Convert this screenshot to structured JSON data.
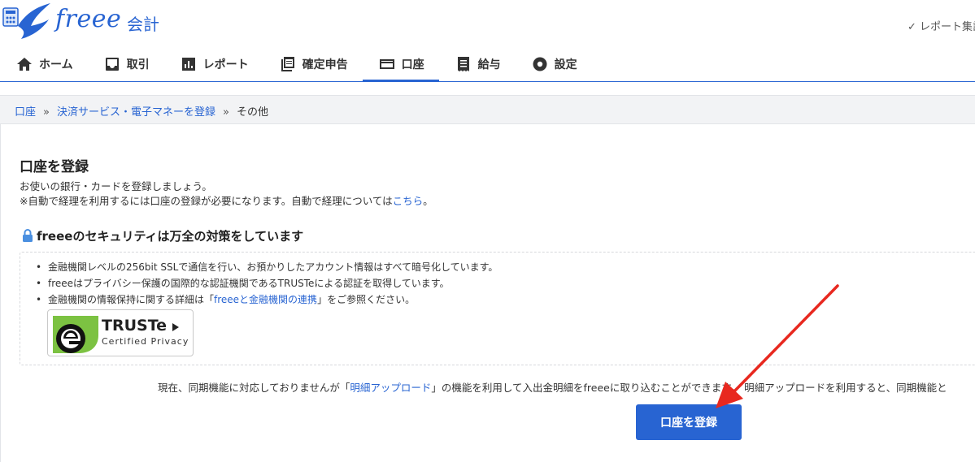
{
  "header": {
    "logo_text": "freee",
    "product": "会計",
    "report_link": "✓ レポート集計"
  },
  "nav": {
    "items": [
      {
        "label": "ホーム",
        "icon": "home-icon"
      },
      {
        "label": "取引",
        "icon": "inbox-icon"
      },
      {
        "label": "レポート",
        "icon": "bar-chart-icon"
      },
      {
        "label": "確定申告",
        "icon": "document-stack-icon"
      },
      {
        "label": "口座",
        "icon": "card-icon"
      },
      {
        "label": "給与",
        "icon": "receipt-icon"
      },
      {
        "label": "設定",
        "icon": "gear-icon"
      }
    ],
    "active_index": 4
  },
  "breadcrumb": {
    "items": [
      "口座",
      "決済サービス・電子マネーを登録",
      "その他"
    ],
    "separator": "»"
  },
  "main": {
    "title": "口座を登録",
    "desc1": "お使いの銀行・カードを登録しましょう。",
    "desc2_prefix": "※自動で経理を利用するには口座の登録が必要になります。自動で経理については",
    "desc2_link": "こちら",
    "desc2_suffix": "。"
  },
  "security": {
    "title": "freeeのセキュリティは万全の対策をしています",
    "items": [
      {
        "text": "金融機関レベルの256bit SSLで通信を行い、お預かりしたアカウント情報はすべて暗号化しています。"
      },
      {
        "text": "freeeはプライバシー保護の国際的な認証機関であるTRUSTeによる認証を取得しています。"
      },
      {
        "prefix": "金融機関の情報保持に関する詳細は「",
        "link": "freeeと金融機関の連携",
        "suffix": "」をご参照ください。"
      }
    ],
    "badge_main": "TRUSTe",
    "badge_sub": "Certified Privacy"
  },
  "bottom_note": {
    "prefix": "現在、同期機能に対応しておりませんが「",
    "link": "明細アップロード",
    "suffix": "」の機能を利用して入出金明細をfreeeに取り込むことができます。 明細アップロードを利用すると、同期機能と"
  },
  "register_button": "口座を登録",
  "colors": {
    "accent": "#2864d2",
    "annotation_arrow": "#e8281f",
    "badge_green": "#7cc242"
  }
}
